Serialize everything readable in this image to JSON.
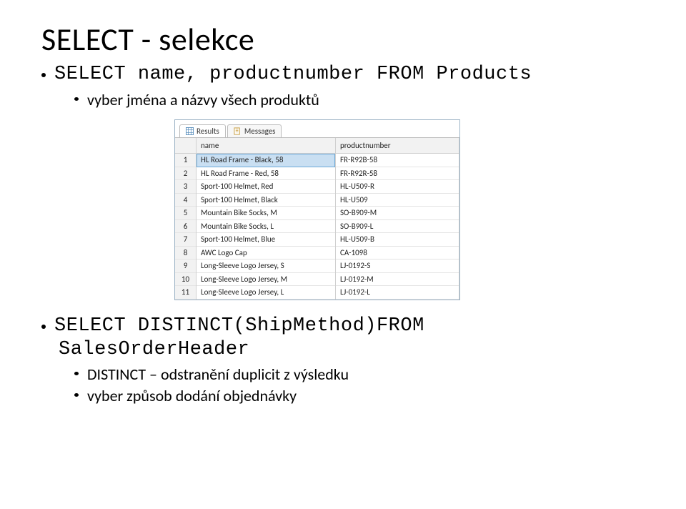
{
  "title": "SELECT - selekce",
  "code1": "SELECT name, productnumber FROM Products",
  "sub1": "vyber jména a názvy všech produktů",
  "tabs": {
    "results": "Results",
    "messages": "Messages"
  },
  "table": {
    "headers": {
      "name": "name",
      "productnumber": "productnumber"
    },
    "rows": [
      {
        "n": "1",
        "name": "HL Road Frame - Black, 58",
        "pn": "FR-R92B-58"
      },
      {
        "n": "2",
        "name": "HL Road Frame - Red, 58",
        "pn": "FR-R92R-58"
      },
      {
        "n": "3",
        "name": "Sport-100 Helmet, Red",
        "pn": "HL-U509-R"
      },
      {
        "n": "4",
        "name": "Sport-100 Helmet, Black",
        "pn": "HL-U509"
      },
      {
        "n": "5",
        "name": "Mountain Bike Socks, M",
        "pn": "SO-B909-M"
      },
      {
        "n": "6",
        "name": "Mountain Bike Socks, L",
        "pn": "SO-B909-L"
      },
      {
        "n": "7",
        "name": "Sport-100 Helmet, Blue",
        "pn": "HL-U509-B"
      },
      {
        "n": "8",
        "name": "AWC Logo Cap",
        "pn": "CA-1098"
      },
      {
        "n": "9",
        "name": "Long-Sleeve Logo Jersey, S",
        "pn": "LJ-0192-S"
      },
      {
        "n": "10",
        "name": "Long-Sleeve Logo Jersey, M",
        "pn": "LJ-0192-M"
      },
      {
        "n": "11",
        "name": "Long-Sleeve Logo Jersey, L",
        "pn": "LJ-0192-L"
      }
    ]
  },
  "code2a": "SELECT DISTINCT(ShipMethod)FROM",
  "code2b": "SalesOrderHeader",
  "sub2a": "DISTINCT – odstranění duplicit z výsledku",
  "sub2b": "vyber způsob dodání objednávky"
}
